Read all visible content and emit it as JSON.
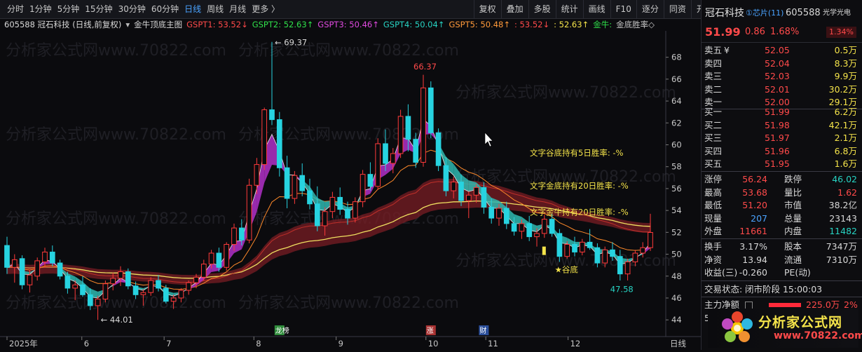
{
  "toolbar": {
    "left": [
      {
        "label": "分时"
      },
      {
        "label": "1分钟"
      },
      {
        "label": "5分钟"
      },
      {
        "label": "15分钟"
      },
      {
        "label": "30分钟"
      },
      {
        "label": "60分钟"
      },
      {
        "label": "日线",
        "active": true
      },
      {
        "label": "周线"
      },
      {
        "label": "月线"
      },
      {
        "label": "更多 〉"
      }
    ],
    "right": [
      {
        "label": "复权"
      },
      {
        "label": "叠加"
      },
      {
        "label": "多股"
      },
      {
        "label": "统计"
      },
      {
        "label": "画线"
      },
      {
        "label": "F10"
      },
      {
        "label": "逐分"
      },
      {
        "label": "同资"
      },
      {
        "label": "开资"
      },
      {
        "label": "简框"
      },
      {
        "label": "小窗"
      },
      {
        "label": "标记"
      },
      {
        "label": "+自选"
      },
      {
        "label": "返回"
      }
    ]
  },
  "indicator_bar": {
    "stock": "605588 冠石科技 (日线,前复权)",
    "main_indicator": "金牛顶底主图",
    "items": [
      {
        "label": "GSPT1: 53.52↓",
        "color": "#ff4a4a"
      },
      {
        "label": "GSPT2: 52.63↑",
        "color": "#2fe04a"
      },
      {
        "label": "GSPT3: 50.46↑",
        "color": "#e04ae0"
      },
      {
        "label": "GSPT4: 50.04↑",
        "color": "#27d3c3"
      },
      {
        "label": "GSPT5: 50.48↑",
        "color": "#ff9a3a"
      },
      {
        "label": ": 53.52↓",
        "color": "#ff4a4a"
      },
      {
        "label": ": 52.63↑",
        "color": "#f5e44a"
      },
      {
        "label": "金牛:",
        "color": "#2fe04a"
      },
      {
        "label": "金底胜率◇",
        "color": "#c8c8c8"
      }
    ]
  },
  "watermark": "分析家公式网www.70822.com",
  "chart_data": {
    "type": "candlestick",
    "yaxis": {
      "ticks": [
        44,
        46,
        48,
        50,
        52,
        54,
        56,
        58,
        60,
        62,
        64,
        66,
        68
      ],
      "range": [
        43.5,
        69.9
      ]
    },
    "xaxis": {
      "ticks": [
        {
          "label": "2025年",
          "pos": 0
        },
        {
          "label": "6",
          "pos": 10
        },
        {
          "label": "7",
          "pos": 21
        },
        {
          "label": "8",
          "pos": 33
        },
        {
          "label": "9",
          "pos": 44
        },
        {
          "label": "10",
          "pos": 56
        },
        {
          "label": "11",
          "pos": 64
        },
        {
          "label": "12",
          "pos": 75
        }
      ],
      "period_label": "日线"
    },
    "candles": [
      [
        50.8,
        51.6,
        48.2,
        48.8
      ],
      [
        48.8,
        50.0,
        47.4,
        49.5
      ],
      [
        49.6,
        49.9,
        46.8,
        47.2
      ],
      [
        47.2,
        48.6,
        46.5,
        48.1
      ],
      [
        48.0,
        49.7,
        47.6,
        49.4
      ],
      [
        49.3,
        50.6,
        48.8,
        50.2
      ],
      [
        50.2,
        50.8,
        48.9,
        49.2
      ],
      [
        49.2,
        49.5,
        47.7,
        48.0
      ],
      [
        48.0,
        48.4,
        46.4,
        46.9
      ],
      [
        46.9,
        47.6,
        45.8,
        47.2
      ],
      [
        47.2,
        48.0,
        46.1,
        46.3
      ],
      [
        46.3,
        46.9,
        44.9,
        45.3
      ],
      [
        45.3,
        46.2,
        44.0,
        45.9
      ],
      [
        45.9,
        47.6,
        45.6,
        47.3
      ],
      [
        47.3,
        48.3,
        46.7,
        47.8
      ],
      [
        47.8,
        48.9,
        47.1,
        48.4
      ],
      [
        48.4,
        48.7,
        46.8,
        47.1
      ],
      [
        47.1,
        47.5,
        45.9,
        46.3
      ],
      [
        46.3,
        46.8,
        45.3,
        46.5
      ],
      [
        46.5,
        47.9,
        46.2,
        47.6
      ],
      [
        47.6,
        48.1,
        46.6,
        46.9
      ],
      [
        46.9,
        47.2,
        45.5,
        45.7
      ],
      [
        45.7,
        46.3,
        45.0,
        46.0
      ],
      [
        46.0,
        46.9,
        45.6,
        46.7
      ],
      [
        46.7,
        47.6,
        46.3,
        47.4
      ],
      [
        47.4,
        48.2,
        46.9,
        47.9
      ],
      [
        47.9,
        49.5,
        47.6,
        49.1
      ],
      [
        49.1,
        50.4,
        48.7,
        50.1
      ],
      [
        50.1,
        50.6,
        48.4,
        48.8
      ],
      [
        48.8,
        51.1,
        48.5,
        50.9
      ],
      [
        50.9,
        52.8,
        50.3,
        52.4
      ],
      [
        52.4,
        53.2,
        50.8,
        51.3
      ],
      [
        51.3,
        56.9,
        51.0,
        56.3
      ],
      [
        56.3,
        58.8,
        55.5,
        58.2
      ],
      [
        58.2,
        63.4,
        57.7,
        63.2
      ],
      [
        63.2,
        69.4,
        61.8,
        62.3
      ],
      [
        62.3,
        63.0,
        57.1,
        57.9
      ],
      [
        57.9,
        59.0,
        54.2,
        55.1
      ],
      [
        55.1,
        57.6,
        54.6,
        57.2
      ],
      [
        57.2,
        58.3,
        55.3,
        55.8
      ],
      [
        55.8,
        56.9,
        54.1,
        54.6
      ],
      [
        54.6,
        56.2,
        52.1,
        52.6
      ],
      [
        52.6,
        54.3,
        51.7,
        53.9
      ],
      [
        53.9,
        55.7,
        53.3,
        55.2
      ],
      [
        55.2,
        56.1,
        53.6,
        54.1
      ],
      [
        54.1,
        54.8,
        52.7,
        53.3
      ],
      [
        53.3,
        55.2,
        52.9,
        54.8
      ],
      [
        54.8,
        57.7,
        54.3,
        57.3
      ],
      [
        57.3,
        58.4,
        55.8,
        56.2
      ],
      [
        56.2,
        60.6,
        55.9,
        60.1
      ],
      [
        60.1,
        61.4,
        57.6,
        58.3
      ],
      [
        58.3,
        59.7,
        57.4,
        59.2
      ],
      [
        59.2,
        63.2,
        58.8,
        62.6
      ],
      [
        62.6,
        63.7,
        59.4,
        60.5
      ],
      [
        60.5,
        61.1,
        57.9,
        58.4
      ],
      [
        58.4,
        66.4,
        58.0,
        65.2
      ],
      [
        65.2,
        65.8,
        60.6,
        61.1
      ],
      [
        61.1,
        61.5,
        57.6,
        58.1
      ],
      [
        58.1,
        58.9,
        55.3,
        55.8
      ],
      [
        55.8,
        57.1,
        55.1,
        56.6
      ],
      [
        56.6,
        57.3,
        54.4,
        54.9
      ],
      [
        54.9,
        55.7,
        53.3,
        55.4
      ],
      [
        55.4,
        56.4,
        54.7,
        56.1
      ],
      [
        56.1,
        56.6,
        53.7,
        54.3
      ],
      [
        54.3,
        55.1,
        52.8,
        53.3
      ],
      [
        53.3,
        54.6,
        52.6,
        54.2
      ],
      [
        54.2,
        54.8,
        52.3,
        52.8
      ],
      [
        52.8,
        53.4,
        51.7,
        52.1
      ],
      [
        52.1,
        53.2,
        51.4,
        52.8
      ],
      [
        52.8,
        53.5,
        51.2,
        51.6
      ],
      [
        51.6,
        52.4,
        50.7,
        51.9
      ],
      [
        51.9,
        53.6,
        51.5,
        53.2
      ],
      [
        53.2,
        53.7,
        51.6,
        51.9
      ],
      [
        51.9,
        52.3,
        49.3,
        49.8
      ],
      [
        49.8,
        51.2,
        49.6,
        50.9
      ],
      [
        50.9,
        51.6,
        49.8,
        50.2
      ],
      [
        50.2,
        51.4,
        49.9,
        51.1
      ],
      [
        51.1,
        52.3,
        50.4,
        50.6
      ],
      [
        50.6,
        51.0,
        48.8,
        49.2
      ],
      [
        49.2,
        50.7,
        48.8,
        50.4
      ],
      [
        50.4,
        51.1,
        49.4,
        49.8
      ],
      [
        49.8,
        50.4,
        47.6,
        48.2
      ],
      [
        48.2,
        49.6,
        47.6,
        49.3
      ],
      [
        49.3,
        50.4,
        48.9,
        50.1
      ],
      [
        50.1,
        51.1,
        49.7,
        50.6
      ],
      [
        50.6,
        53.7,
        50.3,
        51.99
      ]
    ],
    "annotations": [
      {
        "label": "69.37",
        "idx": 35,
        "value": 69.37,
        "color": "#d8d8d8",
        "prefix": "← "
      },
      {
        "label": "66.37",
        "idx": 55,
        "value": 66.37,
        "color": "#ff4a4a",
        "pos": "above"
      },
      {
        "label": "44.01",
        "idx": 12,
        "value": 44.01,
        "color": "#d8d8d8",
        "prefix": "← "
      },
      {
        "label": "47.58",
        "idx": 81,
        "value": 47.58,
        "color": "#27d3c3",
        "pos": "below"
      },
      {
        "label": "★谷底",
        "idx": 72,
        "value": 48.6,
        "color": "#f5e44a"
      }
    ],
    "notes": [
      {
        "label": "文字谷底持有5日胜率: -%",
        "color": "#f5e44a",
        "value": 59.0
      },
      {
        "label": "文字金底持有20日胜率: -%",
        "color": "#f5e44a",
        "value": 56.0
      },
      {
        "label": "文字金牛持有20日胜率: -%",
        "color": "#f5e44a",
        "value": 53.6
      }
    ],
    "bottom_markers": [
      {
        "label": "龙榜",
        "idx": 36,
        "bg": "#2e8b3a"
      },
      {
        "label": "涨",
        "idx": 56,
        "bg": "#a83232"
      },
      {
        "label": "财",
        "idx": 63,
        "bg": "#2a4e9a"
      }
    ]
  },
  "quote": {
    "name": "冠石科技",
    "tags": "①芯片(11)",
    "code": "605588",
    "sector": "光学光电",
    "price": "51.99",
    "change": "0.86",
    "change_pct": "1.68%",
    "turnover_badge": "1.34%",
    "asks": [
      {
        "label": "卖五",
        "extra": "¥",
        "price": "52.05",
        "vol": "0.5万"
      },
      {
        "label": "卖四",
        "price": "52.04",
        "vol": "8.3万"
      },
      {
        "label": "卖三",
        "price": "52.03",
        "vol": "9.9万"
      },
      {
        "label": "卖二",
        "price": "52.01",
        "vol": "30.2万"
      },
      {
        "label": "卖一",
        "price": "52.00",
        "vol": "29.1万"
      }
    ],
    "bids": [
      {
        "label": "买一",
        "price": "51.99",
        "vol": "6.2万"
      },
      {
        "label": "买二",
        "price": "51.98",
        "vol": "42.1万"
      },
      {
        "label": "买三",
        "price": "51.97",
        "vol": "2.1万"
      },
      {
        "label": "买四",
        "price": "51.96",
        "vol": "6.8万"
      },
      {
        "label": "买五",
        "price": "51.95",
        "vol": "1.6万"
      }
    ],
    "stats1": [
      [
        {
          "k": "涨停",
          "v": "56.24",
          "c": "red"
        },
        {
          "k": "跌停",
          "v": "46.02",
          "c": "green"
        }
      ],
      [
        {
          "k": "最高",
          "v": "53.68",
          "c": "red"
        },
        {
          "k": "量比",
          "v": "1.62",
          "c": "red"
        }
      ],
      [
        {
          "k": "最低",
          "v": "51.20",
          "c": "red"
        },
        {
          "k": "市值",
          "v": "38.2亿",
          "c": "white"
        }
      ],
      [
        {
          "k": "现量",
          "v": "207",
          "c": "blue"
        },
        {
          "k": "总量",
          "v": "23143",
          "c": "white"
        }
      ],
      [
        {
          "k": "外盘",
          "v": "11661",
          "c": "red"
        },
        {
          "k": "内盘",
          "v": "11482",
          "c": "green"
        }
      ]
    ],
    "stats2": [
      [
        {
          "k": "换手",
          "v": "3.17%",
          "c": "white"
        },
        {
          "k": "股本",
          "v": "7347万",
          "c": "white"
        }
      ],
      [
        {
          "k": "净资",
          "v": "13.94",
          "c": "white"
        },
        {
          "k": "流通",
          "v": "7310万",
          "c": "white"
        }
      ],
      [
        {
          "k": "收益(三)",
          "v": "-0.260",
          "c": "white"
        },
        {
          "k": "PE(动)",
          "v": "",
          "c": "white"
        }
      ]
    ],
    "trade_status_label": "交易状态:",
    "trade_status": "闭市阶段 15:00:03",
    "main_flow_label": "主力净额",
    "main_flow_value": "225.0万",
    "main_flow_pct": "2%",
    "flow_day_label": "5E"
  },
  "logo": {
    "text": "分析家公式网",
    "url": "www.70822.com"
  }
}
